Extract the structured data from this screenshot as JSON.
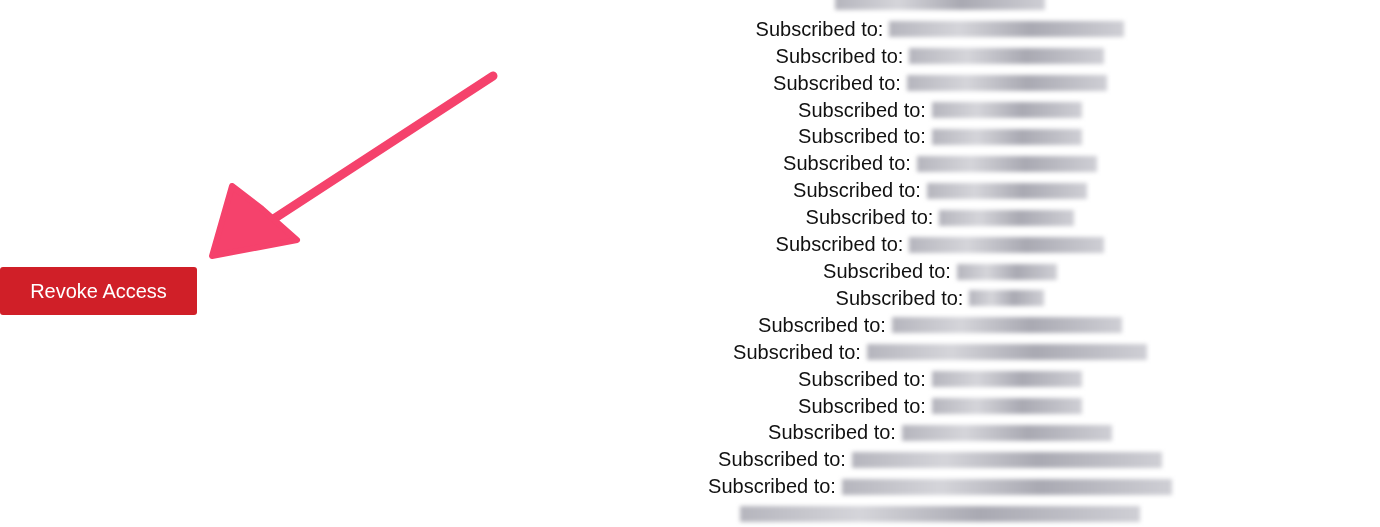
{
  "revoke_button": {
    "label": "Revoke Access"
  },
  "subscriptions": [
    {
      "redacted": true
    },
    {
      "label": "Subscribed to:",
      "redacted": true
    },
    {
      "label": "Subscribed to:",
      "redacted": true
    },
    {
      "label": "Subscribed to:",
      "redacted": true
    },
    {
      "label": "Subscribed to:",
      "redacted": true
    },
    {
      "label": "Subscribed to:",
      "redacted": true
    },
    {
      "label": "Subscribed to:",
      "redacted": true
    },
    {
      "label": "Subscribed to:",
      "redacted": true
    },
    {
      "label": "Subscribed to:",
      "redacted": true
    },
    {
      "label": "Subscribed to:",
      "redacted": true
    },
    {
      "label": "Subscribed to:",
      "redacted": true
    },
    {
      "label": "Subscribed to:",
      "redacted": true
    },
    {
      "label": "Subscribed to:",
      "redacted": true
    },
    {
      "label": "Subscribed to:",
      "redacted": true
    },
    {
      "label": "Subscribed to:",
      "redacted": true
    },
    {
      "label": "Subscribed to:",
      "redacted": true
    },
    {
      "label": "Subscribed to:",
      "redacted": true
    },
    {
      "label": "Subscribed to:",
      "redacted": true
    },
    {
      "label": "Subscribed to:",
      "redacted": true
    },
    {
      "redacted": true
    }
  ]
}
